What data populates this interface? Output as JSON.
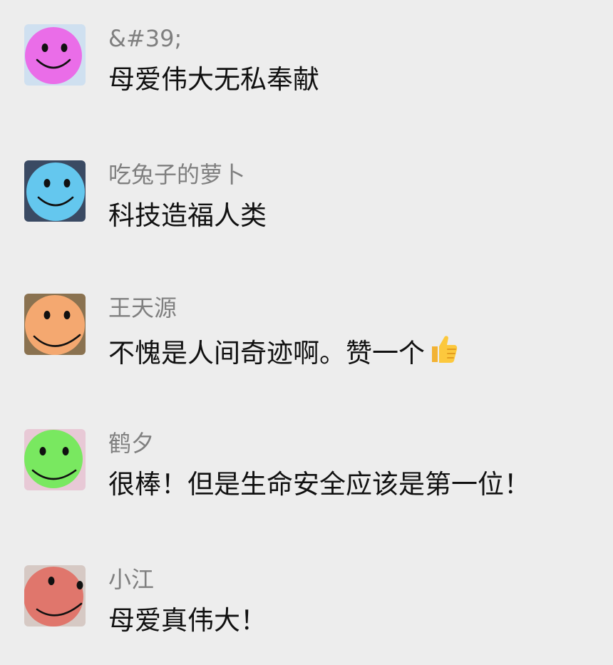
{
  "comments": [
    {
      "name": "&#39;",
      "text": "母爱伟大无私奉献",
      "avatar_icon": "pink-smiley-face-icon",
      "avatar_color": "#ea6de8",
      "avatar_bg": "#cfe0f0"
    },
    {
      "name": "吃兔子的萝卜",
      "text": "科技造福人类",
      "avatar_icon": "blue-smiley-face-icon",
      "avatar_color": "#64c7ee",
      "avatar_bg": "#3a4a63"
    },
    {
      "name": "王天源",
      "text": "不愧是人间奇迹啊。赞一个",
      "avatar_icon": "orange-smiley-face-icon",
      "avatar_color": "#f4a870",
      "avatar_bg": "#8a7250",
      "trailing_emoji": "thumbs-up-icon"
    },
    {
      "name": "鹤夕",
      "text": "很棒！但是生命安全应该是第一位！",
      "avatar_icon": "green-smiley-face-icon",
      "avatar_color": "#79e860",
      "avatar_bg": "#e8c9d6"
    },
    {
      "name": "小江",
      "text": "母爱真伟大！",
      "avatar_icon": "red-smiley-face-icon",
      "avatar_color": "#e0766c",
      "avatar_bg": "#d6c9c4"
    }
  ]
}
